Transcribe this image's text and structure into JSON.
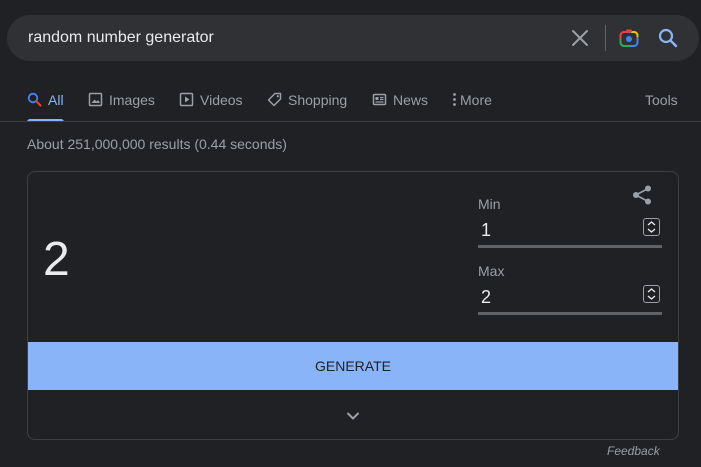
{
  "search": {
    "query": "random number generator",
    "icons": [
      "close-icon",
      "google-lens-icon",
      "search-icon"
    ]
  },
  "tabs": [
    {
      "label": "All",
      "icon": "search-icon",
      "active": true
    },
    {
      "label": "Images",
      "icon": "image-icon"
    },
    {
      "label": "Videos",
      "icon": "play-icon"
    },
    {
      "label": "Shopping",
      "icon": "tag-icon"
    },
    {
      "label": "News",
      "icon": "newspaper-icon"
    },
    {
      "label": "More",
      "icon": "vertical-dots-icon"
    }
  ],
  "tools_label": "Tools",
  "result_stats": "About 251,000,000 results (0.44 seconds)",
  "rng": {
    "result": "2",
    "min_label": "Min",
    "min_value": "1",
    "max_label": "Max",
    "max_value": "2",
    "generate_label": "GENERATE"
  },
  "feedback_label": "Feedback",
  "colors": {
    "background": "#202124",
    "searchbar": "#303134",
    "accent": "#8ab4f8",
    "muted_text": "#9aa0a6",
    "text": "#e8eaed"
  }
}
